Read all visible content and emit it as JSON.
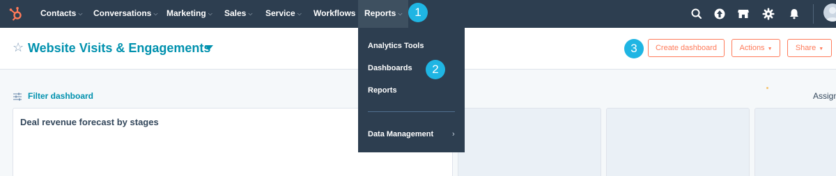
{
  "nav": {
    "items": [
      {
        "label": "Contacts",
        "caret": true
      },
      {
        "label": "Conversations",
        "caret": true
      },
      {
        "label": "Marketing",
        "caret": true
      },
      {
        "label": "Sales",
        "caret": true
      },
      {
        "label": "Service",
        "caret": true
      },
      {
        "label": "Workflows",
        "caret": false
      },
      {
        "label": "Reports",
        "caret": true
      }
    ],
    "caret_glyph": "⌵"
  },
  "header": {
    "title": "Website Visits & Engagements",
    "create_dashboard": "Create dashboard",
    "actions": "Actions",
    "share": "Share"
  },
  "badges": [
    "1",
    "2",
    "3"
  ],
  "filter": {
    "label": "Filter dashboard",
    "assign": "Assign"
  },
  "cards": [
    {
      "title": "Deal revenue forecast by stages"
    }
  ],
  "dropdown": {
    "items": [
      "Analytics Tools",
      "Dashboards",
      "Reports"
    ],
    "data_management": "Data Management"
  },
  "colors": {
    "nav_bg": "#2d3e50",
    "accent": "#0091ae",
    "brand": "#ff7a59",
    "badge": "#1fb5e3"
  }
}
